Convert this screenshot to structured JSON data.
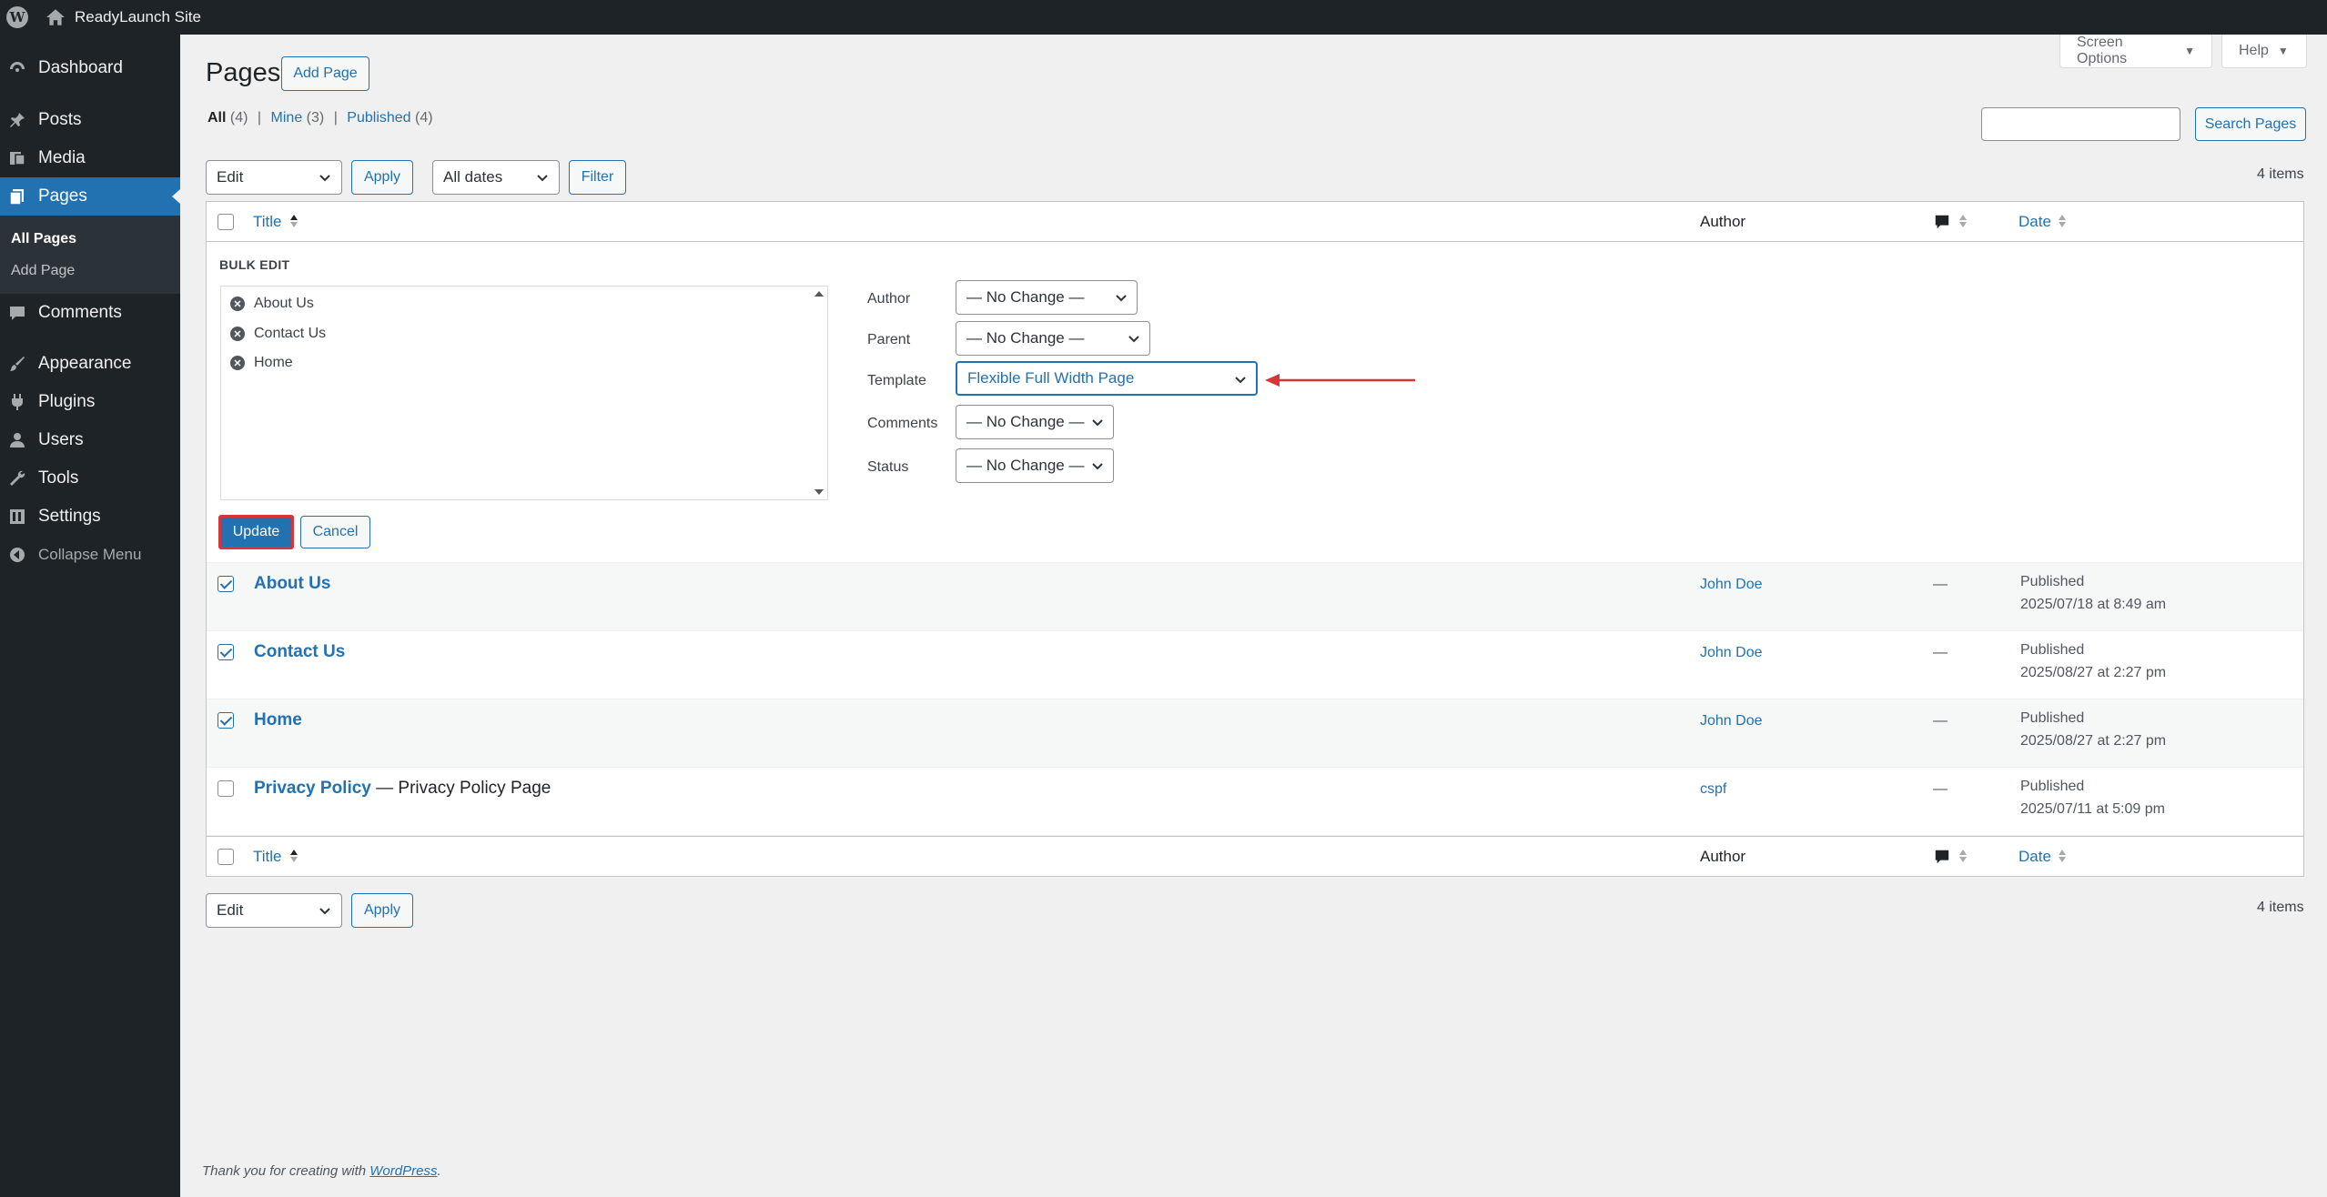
{
  "adminbar": {
    "site_name": "ReadyLaunch Site"
  },
  "sidebar": {
    "items": [
      {
        "label": "Dashboard",
        "icon": "dashboard-icon"
      },
      {
        "label": "Posts",
        "icon": "pin-icon"
      },
      {
        "label": "Media",
        "icon": "media-icon"
      },
      {
        "label": "Pages",
        "icon": "pages-icon"
      },
      {
        "label": "Comments",
        "icon": "comment-icon"
      },
      {
        "label": "Appearance",
        "icon": "brush-icon"
      },
      {
        "label": "Plugins",
        "icon": "plugin-icon"
      },
      {
        "label": "Users",
        "icon": "user-icon"
      },
      {
        "label": "Tools",
        "icon": "wrench-icon"
      },
      {
        "label": "Settings",
        "icon": "settings-icon"
      },
      {
        "label": "Collapse Menu",
        "icon": "collapse-icon"
      }
    ],
    "submenu": [
      "All Pages",
      "Add Page"
    ]
  },
  "header": {
    "title": "Pages",
    "add_button": "Add Page",
    "screen_options": "Screen Options",
    "help": "Help",
    "search_button": "Search Pages"
  },
  "views": {
    "all": "All",
    "all_count": "(4)",
    "mine": "Mine",
    "mine_count": "(3)",
    "published": "Published",
    "published_count": "(4)",
    "sep": "|"
  },
  "toolbar": {
    "bulk_action": "Edit",
    "apply": "Apply",
    "dates": "All dates",
    "filter": "Filter",
    "items_count": "4 items"
  },
  "table": {
    "col_title": "Title",
    "col_author": "Author",
    "col_date": "Date",
    "rows": [
      {
        "title": "About Us",
        "state": "",
        "author": "John Doe",
        "comments": "—",
        "status": "Published",
        "date": "2025/07/18 at 8:49 am",
        "checked": true
      },
      {
        "title": "Contact Us",
        "state": "",
        "author": "John Doe",
        "comments": "—",
        "status": "Published",
        "date": "2025/08/27 at 2:27 pm",
        "checked": true
      },
      {
        "title": "Home",
        "state": "",
        "author": "John Doe",
        "comments": "—",
        "status": "Published",
        "date": "2025/08/27 at 2:27 pm",
        "checked": true
      },
      {
        "title": "Privacy Policy",
        "state": " — Privacy Policy Page",
        "author": "cspf",
        "comments": "—",
        "status": "Published",
        "date": "2025/07/11 at 5:09 pm",
        "checked": false
      }
    ]
  },
  "bulk_edit": {
    "title": "BULK EDIT",
    "items": [
      "About Us",
      "Contact Us",
      "Home"
    ],
    "fields": {
      "author_label": "Author",
      "author_value": "— No Change —",
      "parent_label": "Parent",
      "parent_value": "— No Change —",
      "template_label": "Template",
      "template_value": "Flexible Full Width Page",
      "comments_label": "Comments",
      "comments_value": "— No Change —",
      "status_label": "Status",
      "status_value": "— No Change —"
    },
    "update": "Update",
    "cancel": "Cancel"
  },
  "footer": {
    "thanks": "Thank you for creating with ",
    "wp_link": "WordPress",
    "end": "."
  },
  "colors": {
    "accent": "#2271b1",
    "sidebar": "#1d2327",
    "highlight": "#d63638"
  }
}
